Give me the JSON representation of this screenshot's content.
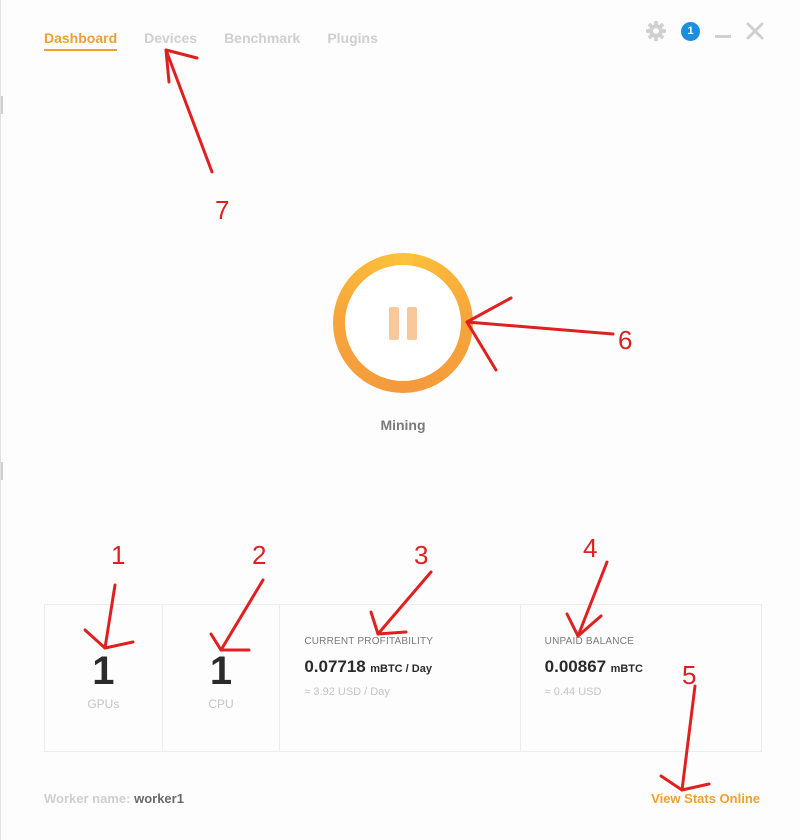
{
  "nav": {
    "tabs": [
      {
        "label": "Dashboard",
        "active": true
      },
      {
        "label": "Devices",
        "active": false
      },
      {
        "label": "Benchmark",
        "active": false
      },
      {
        "label": "Plugins",
        "active": false
      }
    ]
  },
  "controls": {
    "settings_icon": "gear-icon",
    "notification_count": "1",
    "minimize_icon": "minimize-icon",
    "close_icon": "close-icon"
  },
  "mining": {
    "status": "Mining",
    "button_icon": "pause-icon"
  },
  "stats": {
    "gpus": {
      "count": "1",
      "label": "GPUs"
    },
    "cpu": {
      "count": "1",
      "label": "CPU"
    },
    "profitability": {
      "title": "CURRENT PROFITABILITY",
      "value": "0.07718",
      "unit": "mBTC / Day",
      "usd": "≈ 3.92 USD / Day"
    },
    "balance": {
      "title": "UNPAID BALANCE",
      "value": "0.00867",
      "unit": "mBTC",
      "usd": "≈ 0.44 USD"
    }
  },
  "footer": {
    "worker_label": "Worker name:",
    "worker_value": "worker1",
    "view_stats": "View Stats Online"
  },
  "annotations": {
    "n1": "1",
    "n2": "2",
    "n3": "3",
    "n4": "4",
    "n5": "5",
    "n6": "6",
    "n7": "7"
  },
  "colors": {
    "accent": "#f0a030",
    "badge": "#1a8fe0",
    "annotation": "#e02020"
  }
}
